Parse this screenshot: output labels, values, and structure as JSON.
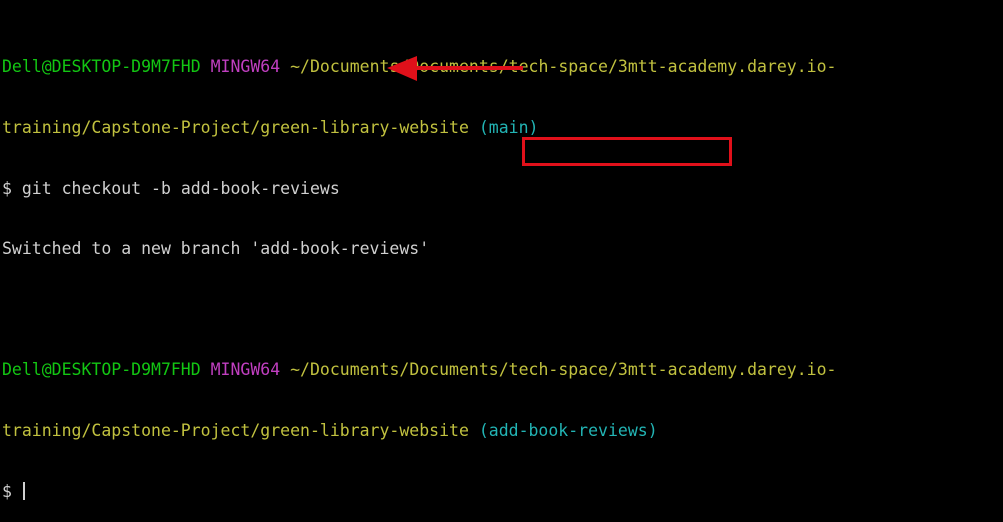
{
  "session": {
    "block1": {
      "user_host": "Dell@DESKTOP-D9M7FHD",
      "shell": "MINGW64",
      "path_line1": "~/Documents/Documents/tech-space/3mtt-academy.darey.io-",
      "path_line2": "training/Capstone-Project/green-library-website",
      "branch": "(main)",
      "prompt": "$",
      "command": "git checkout -b add-book-reviews",
      "output": "Switched to a new branch 'add-book-reviews'"
    },
    "block2": {
      "user_host": "Dell@DESKTOP-D9M7FHD",
      "shell": "MINGW64",
      "path_line1": "~/Documents/Documents/tech-space/3mtt-academy.darey.io-",
      "path_line2": "training/Capstone-Project/green-library-website",
      "branch": "(add-book-reviews)",
      "prompt": "$"
    }
  },
  "annotations": {
    "arrow_color": "#e0101a",
    "box_color": "#e0101a"
  },
  "colors": {
    "background": "#000000",
    "user_host": "#13c613",
    "shell": "#c13fc1",
    "path": "#c1c13f",
    "branch": "#22b4b4",
    "text": "#d0d0d0"
  }
}
